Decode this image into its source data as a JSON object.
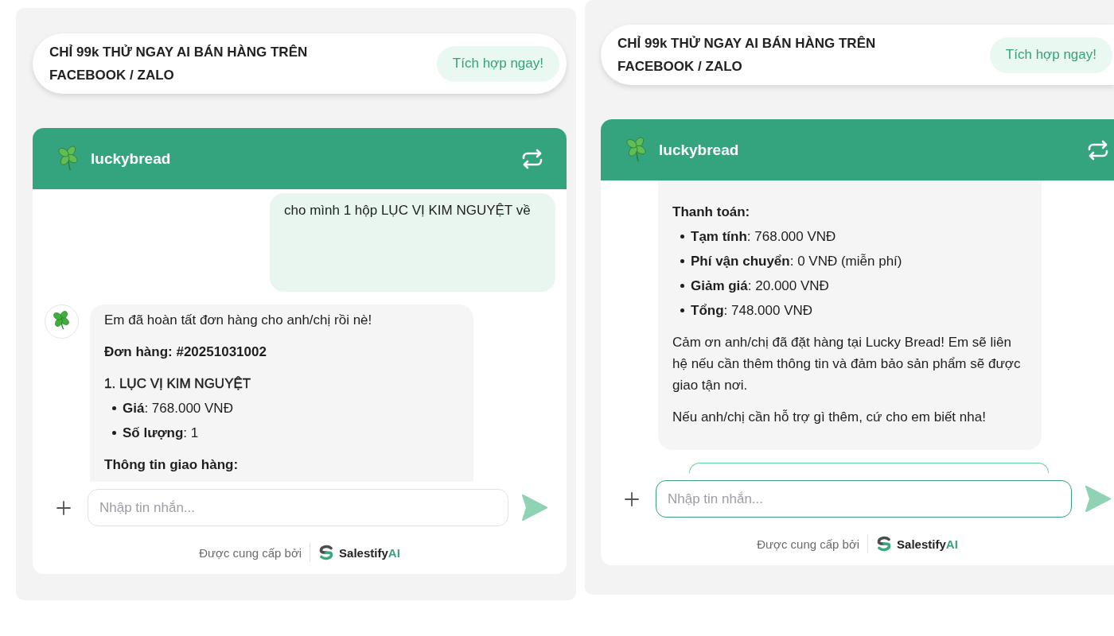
{
  "panels": [
    {
      "promo": {
        "text": "CHỈ 99k THỬ NGAY AI BÁN HÀNG TRÊN FACEBOOK / ZALO",
        "button": "Tích hợp ngay!"
      },
      "chat": {
        "name": "luckybread",
        "scrolled_to_end": false,
        "messages": [
          {
            "kind": "user",
            "text": "cho mình 1 hộp LỤC VỊ KIM NGUYỆT về"
          },
          {
            "kind": "bot",
            "avatar": true,
            "blocks": [
              {
                "kind": "paragraph",
                "text": "Em đã hoàn tất đơn hàng cho anh/chị rồi nè!"
              },
              {
                "kind": "heading",
                "text": "Đơn hàng: #20251031002"
              },
              {
                "kind": "title",
                "text": "1. LỤC VỊ KIM NGUYỆT"
              },
              {
                "kind": "list",
                "items": [
                  "**Giá**: 768.000 VNĐ",
                  "**Số lượng**: 1"
                ]
              },
              {
                "kind": "heading",
                "text": "Thông tin giao hàng:"
              }
            ]
          }
        ],
        "input": {
          "placeholder": "Nhập tin nhắn...",
          "focused": false
        },
        "footer": {
          "label": "Được cung cấp bởi",
          "brand": "Salestify",
          "brand_accent": "AI"
        }
      }
    },
    {
      "promo": {
        "text": "CHỈ 99k THỬ NGAY AI BÁN HÀNG TRÊN FACEBOOK / ZALO",
        "button": "Tích hợp ngay!"
      },
      "chat": {
        "name": "luckybread",
        "scrolled_to_end": true,
        "messages": [
          {
            "kind": "bot",
            "avatar": false,
            "blocks": [
              {
                "kind": "heading",
                "text": "Thanh toán:"
              },
              {
                "kind": "list",
                "items": [
                  "**Tạm tính**: 768.000 VNĐ",
                  "**Phí vận chuyển**: 0 VNĐ (miễn phí)",
                  "**Giảm giá**: 20.000 VNĐ",
                  "**Tổng**: 748.000 VNĐ"
                ]
              },
              {
                "kind": "paragraph",
                "text": "Cảm ơn anh/chị đã đặt hàng tại Lucky Bread! Em sẽ liên hệ nếu cần thêm thông tin và đảm bảo sản phẩm sẽ được giao tận nơi."
              },
              {
                "kind": "paragraph",
                "text": "Nếu anh/chị cần hỗ trợ gì thêm, cứ cho em biết nha!"
              }
            ]
          },
          {
            "kind": "card"
          }
        ],
        "input": {
          "placeholder": "Nhập tin nhắn...",
          "focused": true
        },
        "footer": {
          "label": "Được cung cấp bởi",
          "brand": "Salestify",
          "brand_accent": "AI"
        }
      }
    }
  ]
}
